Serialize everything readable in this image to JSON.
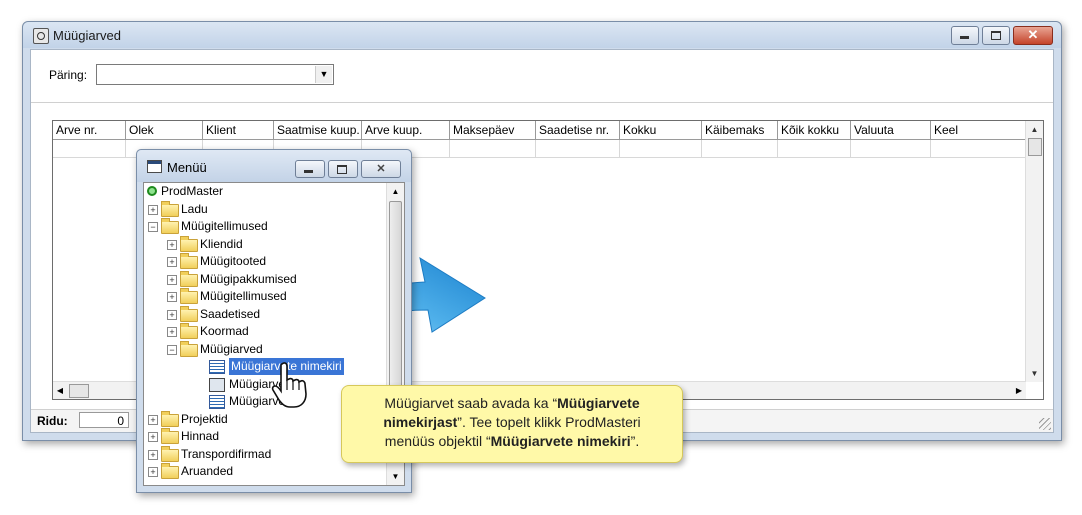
{
  "main_window": {
    "title": "Müügiarved",
    "query_label": "Päring:",
    "query_value": "",
    "columns": [
      {
        "label": "Arve nr."
      },
      {
        "label": "Olek"
      },
      {
        "label": "Klient"
      },
      {
        "label": "Saatmise kuup."
      },
      {
        "label": "Arve kuup."
      },
      {
        "label": "Maksepäev"
      },
      {
        "label": "Saadetise nr."
      },
      {
        "label": "Kokku"
      },
      {
        "label": "Käibemaks"
      },
      {
        "label": "Kõik kokku"
      },
      {
        "label": "Valuuta"
      },
      {
        "label": "Keel"
      }
    ],
    "status": {
      "rows_label": "Ridu:",
      "rows_value": "0"
    }
  },
  "menu_window": {
    "title": "Menüü",
    "tree": [
      {
        "label": "ProdMaster",
        "level": 0,
        "icon": "root-icon",
        "expander": ""
      },
      {
        "label": "Ladu",
        "level": 1,
        "icon": "folder-icon",
        "expander": "+"
      },
      {
        "label": "Müügitellimused",
        "level": 1,
        "icon": "folder-open-icon",
        "expander": "−"
      },
      {
        "label": "Kliendid",
        "level": 2,
        "icon": "folder-icon",
        "expander": "+"
      },
      {
        "label": "Müügitooted",
        "level": 2,
        "icon": "folder-icon",
        "expander": "+"
      },
      {
        "label": "Müügipakkumised",
        "level": 2,
        "icon": "folder-icon",
        "expander": "+"
      },
      {
        "label": "Müügitellimused",
        "level": 2,
        "icon": "folder-icon",
        "expander": "+"
      },
      {
        "label": "Saadetised",
        "level": 2,
        "icon": "folder-icon",
        "expander": "+"
      },
      {
        "label": "Koormad",
        "level": 2,
        "icon": "folder-icon",
        "expander": "+"
      },
      {
        "label": "Müügiarved",
        "level": 2,
        "icon": "folder-open-icon",
        "expander": "−"
      },
      {
        "label": "Müügiarvete nimekiri",
        "level": 3,
        "icon": "grid-icon",
        "expander": "",
        "selected": true
      },
      {
        "label": "Müügiarve",
        "level": 3,
        "icon": "form-icon",
        "expander": ""
      },
      {
        "label": "Müügiarved",
        "level": 3,
        "icon": "grid-icon",
        "expander": ""
      },
      {
        "label": "Projektid",
        "level": 1,
        "icon": "folder-icon",
        "expander": "+"
      },
      {
        "label": "Hinnad",
        "level": 1,
        "icon": "folder-icon",
        "expander": "+"
      },
      {
        "label": "Transpordifirmad",
        "level": 1,
        "icon": "folder-icon",
        "expander": "+"
      },
      {
        "label": "Aruanded",
        "level": 1,
        "icon": "folder-icon",
        "expander": "+"
      }
    ]
  },
  "callout": {
    "line1_plain": "Müügiarvet saab avada ka “",
    "line1_bold": "Müügiarvete",
    "line2_bold": "nimekirjast",
    "line2_plain": "”.  Tee topelt klikk ProdMasteri",
    "line3_plain_a": "menüüs objektil “",
    "line3_bold": "Müügiarvete nimekiri",
    "line3_plain_b": "”."
  },
  "colors": {
    "accent": "#3a75d6",
    "callout_bg": "#fff9a8",
    "arrow": "#2f9be0"
  }
}
